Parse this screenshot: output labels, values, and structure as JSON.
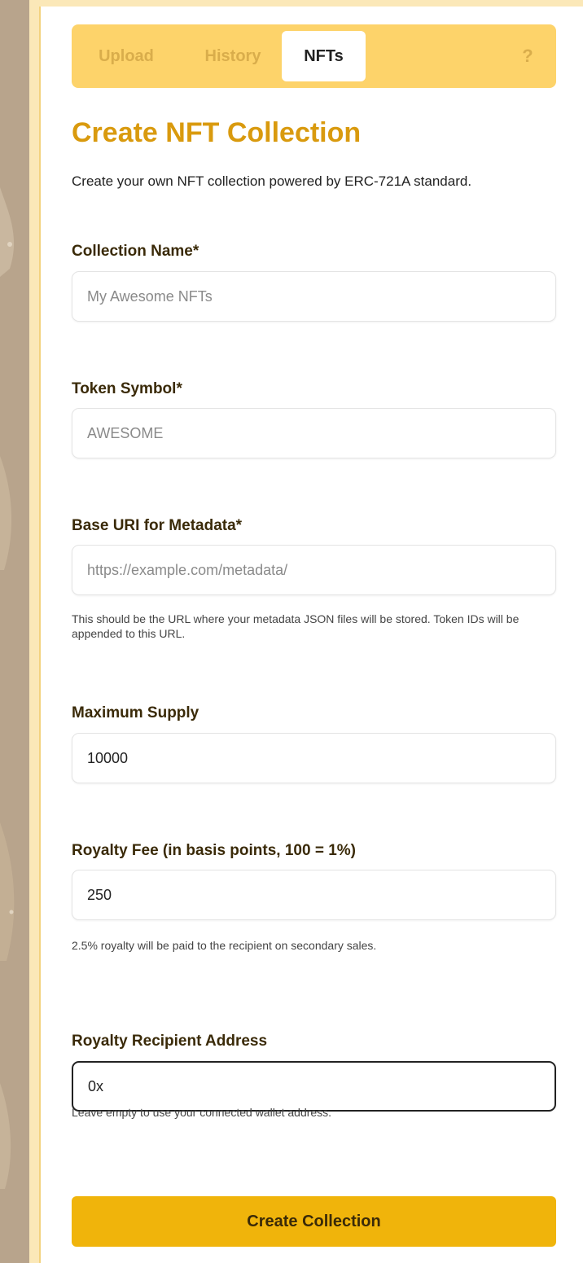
{
  "tabs": {
    "upload": "Upload",
    "history": "History",
    "nfts": "NFTs",
    "help": "?"
  },
  "page": {
    "title": "Create NFT Collection",
    "description": "Create your own NFT collection powered by ERC-721A standard."
  },
  "form": {
    "collection_name": {
      "label": "Collection Name*",
      "placeholder": "My Awesome NFTs",
      "value": ""
    },
    "token_symbol": {
      "label": "Token Symbol*",
      "placeholder": "AWESOME",
      "value": ""
    },
    "base_uri": {
      "label": "Base URI for Metadata*",
      "placeholder": "https://example.com/metadata/",
      "value": "",
      "hint": "This should be the URL where your metadata JSON files will be stored. Token IDs will be appended to this URL."
    },
    "max_supply": {
      "label": "Maximum Supply",
      "value": "10000"
    },
    "royalty_fee": {
      "label": "Royalty Fee (in basis points, 100 = 1%)",
      "value": "250",
      "hint": "2.5% royalty will be paid to the recipient on secondary sales."
    },
    "royalty_recipient": {
      "label": "Royalty Recipient Address",
      "value": "0x",
      "hint": "Leave empty to use your connected wallet address."
    },
    "submit_label": "Create Collection"
  },
  "colors": {
    "accent": "#f0b40b",
    "tabbar": "#fdd36a",
    "title": "#d99a0e"
  }
}
